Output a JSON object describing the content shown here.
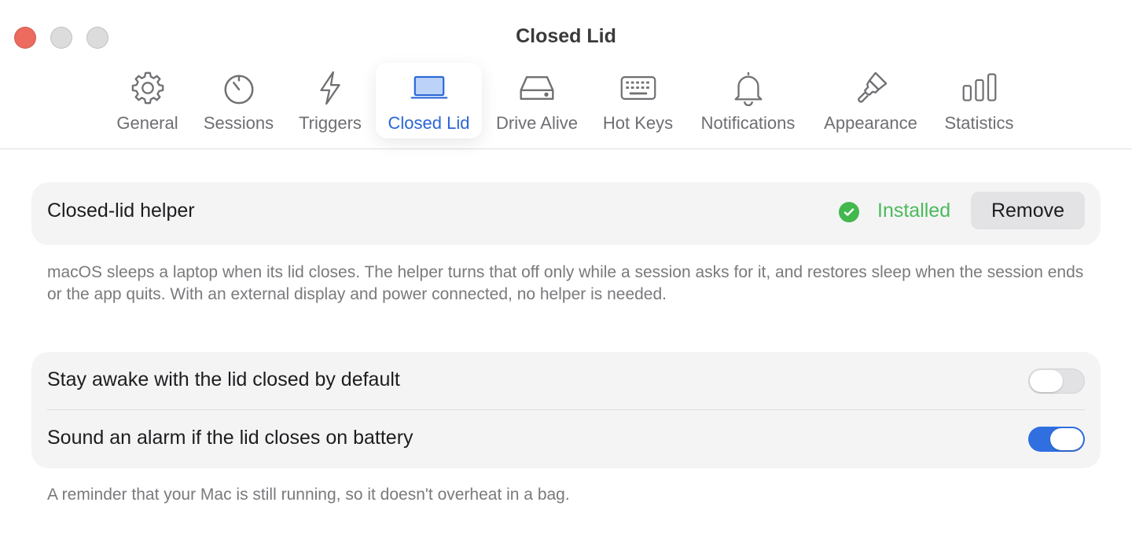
{
  "window": {
    "title": "Closed Lid"
  },
  "toolbar": {
    "tabs": [
      {
        "label": "General",
        "icon": "gear-icon"
      },
      {
        "label": "Sessions",
        "icon": "timer-icon"
      },
      {
        "label": "Triggers",
        "icon": "bolt-icon"
      },
      {
        "label": "Closed Lid",
        "icon": "laptop-icon",
        "active": true
      },
      {
        "label": "Drive Alive",
        "icon": "drive-icon"
      },
      {
        "label": "Hot Keys",
        "icon": "keyboard-icon"
      },
      {
        "label": "Notifications",
        "icon": "bell-icon"
      },
      {
        "label": "Appearance",
        "icon": "paintbrush-icon"
      },
      {
        "label": "Statistics",
        "icon": "bar-chart-icon"
      }
    ]
  },
  "helper": {
    "label": "Closed-lid helper",
    "status": "Installed",
    "status_icon": "checkmark-circle-icon",
    "remove_label": "Remove",
    "description": "macOS sleeps a laptop when its lid closes. The helper turns that off only while a session asks for it, and restores sleep when the session ends or the app quits. With an external display and power connected, no helper is needed."
  },
  "preferences": {
    "rows": [
      {
        "label": "Stay awake with the lid closed by default",
        "enabled": false
      },
      {
        "label": "Sound an alarm if the lid closes on battery",
        "enabled": true
      }
    ],
    "footnote": "A reminder that your Mac is still running, so it doesn't overheat in a bag."
  },
  "colors": {
    "accent": "#2a66d6",
    "toggle_on": "#2f6fe0",
    "status_green": "#4cba5b",
    "close_button": "#ec6a5e"
  }
}
